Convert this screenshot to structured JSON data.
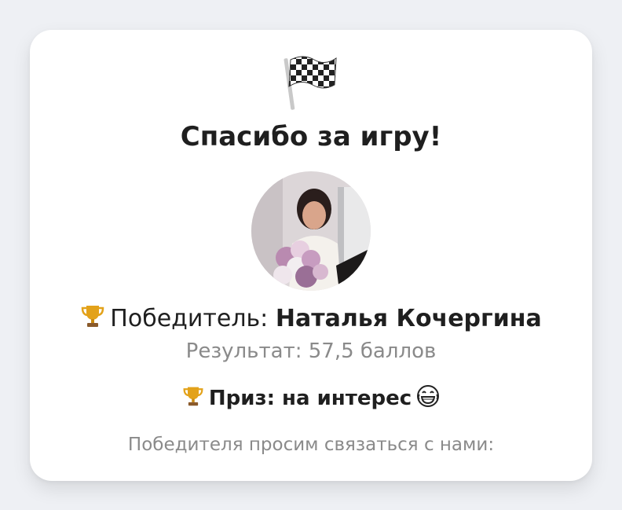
{
  "card": {
    "flag_icon": "chequered-flag-icon",
    "title": "Спасибо за игру!",
    "winner_label": "Победитель:",
    "winner_name": "Наталья Кочергина",
    "result": "Результат: 57,5 баллов",
    "prize": "Приз: на интерес",
    "contact": "Победителя просим связаться с нами:"
  },
  "icons": {
    "winner_trophy": "trophy-icon",
    "prize_trophy": "trophy-icon",
    "prize_emoji": "tears-of-joy-icon"
  },
  "colors": {
    "background": "#eef0f4",
    "card": "#ffffff",
    "text": "#1f1f1f",
    "muted": "#8a8a8a",
    "trophy": "#e3a21a"
  }
}
